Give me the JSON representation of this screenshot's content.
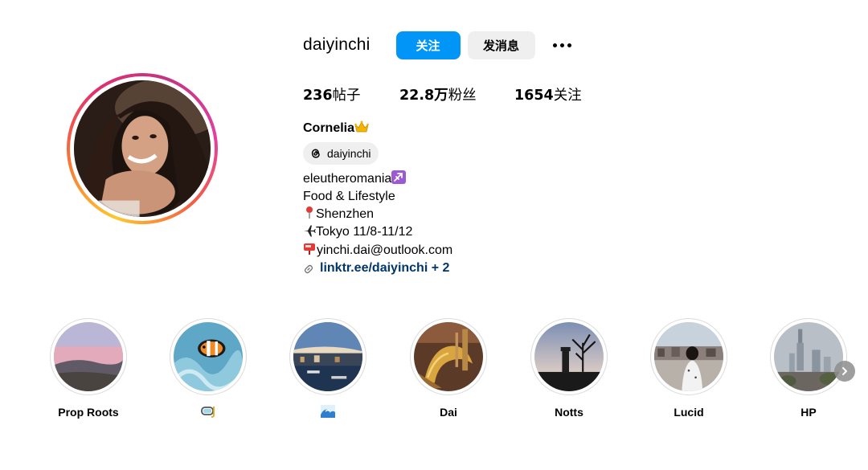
{
  "profile": {
    "username": "daiyinchi",
    "follow_label": "关注",
    "message_label": "发消息",
    "more_icon": "more-horizontal-icon",
    "avatar_icon": "profile-avatar"
  },
  "stats": {
    "posts_count": "236",
    "posts_label": "帖子",
    "followers_count": "22.8万",
    "followers_label": "粉丝",
    "following_count": "1654",
    "following_label": "关注"
  },
  "bio": {
    "full_name": "Cornelia",
    "full_name_emoji": "crown-icon",
    "threads_handle": "daiyinchi",
    "threads_icon": "threads-icon",
    "line_1_text": "eleutheromania",
    "line_1_emoji": "sagittarius-icon",
    "line_2_text": "Food & Lifestyle",
    "line_3_text": "Shenzhen",
    "line_3_emoji": "pin-icon",
    "line_4_text": "Tokyo 11/8-11/12",
    "line_4_emoji": "airplane-icon",
    "line_5_text": "yinchi.dai@outlook.com",
    "line_5_emoji": "mailbox-icon",
    "link_text": "linktr.ee/daiyinchi + 2",
    "link_icon": "link-icon"
  },
  "highlights": [
    {
      "label": "Prop Roots"
    },
    {
      "label": "",
      "emoji": "diving-mask-icon"
    },
    {
      "label": "",
      "emoji": "wave-icon"
    },
    {
      "label": "Dai"
    },
    {
      "label": "Notts"
    },
    {
      "label": "Lucid"
    },
    {
      "label": "HP"
    }
  ],
  "controls": {
    "next_icon": "chevron-right-icon"
  },
  "colors": {
    "accent": "#0095f6",
    "secondary_button": "#efefef",
    "link": "#00376b",
    "ring_start": "#fdc830",
    "ring_end": "#c13584"
  }
}
